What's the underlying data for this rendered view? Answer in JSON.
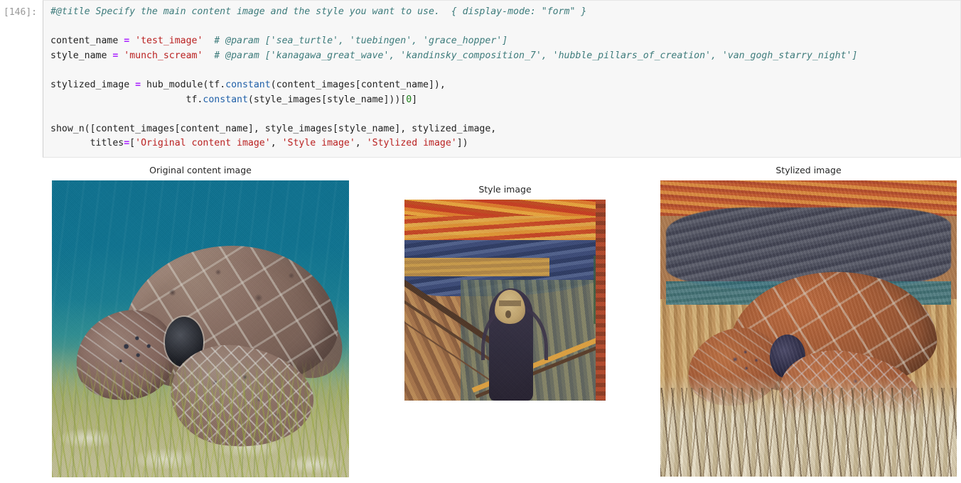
{
  "cell": {
    "prompt": "[146]:",
    "code_lines": [
      [
        {
          "t": "comment",
          "v": "#@title Specify the main content image and the style you want to use.  { display-mode: \"form\" }"
        }
      ],
      [],
      [
        {
          "t": "name",
          "v": "content_name "
        },
        {
          "t": "op",
          "v": "="
        },
        {
          "t": "plain",
          "v": " "
        },
        {
          "t": "string",
          "v": "'test_image'"
        },
        {
          "t": "plain",
          "v": "  "
        },
        {
          "t": "comment",
          "v": "# @param ['sea_turtle', 'tuebingen', 'grace_hopper']"
        }
      ],
      [
        {
          "t": "name",
          "v": "style_name "
        },
        {
          "t": "op",
          "v": "="
        },
        {
          "t": "plain",
          "v": " "
        },
        {
          "t": "string",
          "v": "'munch_scream'"
        },
        {
          "t": "plain",
          "v": "  "
        },
        {
          "t": "comment",
          "v": "# @param ['kanagawa_great_wave', 'kandinsky_composition_7', 'hubble_pillars_of_creation', 'van_gogh_starry_night']"
        }
      ],
      [],
      [
        {
          "t": "name",
          "v": "stylized_image "
        },
        {
          "t": "op",
          "v": "="
        },
        {
          "t": "plain",
          "v": " hub_module(tf."
        },
        {
          "t": "builtin",
          "v": "constant"
        },
        {
          "t": "plain",
          "v": "(content_images[content_name]),"
        }
      ],
      [
        {
          "t": "plain",
          "v": "                        tf."
        },
        {
          "t": "builtin",
          "v": "constant"
        },
        {
          "t": "plain",
          "v": "(style_images[style_name]))["
        },
        {
          "t": "number",
          "v": "0"
        },
        {
          "t": "plain",
          "v": "]"
        }
      ],
      [],
      [
        {
          "t": "plain",
          "v": "show_n([content_images[content_name], style_images[style_name], stylized_image,"
        }
      ],
      [
        {
          "t": "plain",
          "v": "       titles"
        },
        {
          "t": "op",
          "v": "="
        },
        {
          "t": "plain",
          "v": "["
        },
        {
          "t": "string",
          "v": "'Original content image'"
        },
        {
          "t": "plain",
          "v": ", "
        },
        {
          "t": "string",
          "v": "'Style image'"
        },
        {
          "t": "plain",
          "v": ", "
        },
        {
          "t": "string",
          "v": "'Stylized image'"
        },
        {
          "t": "plain",
          "v": "])"
        }
      ]
    ]
  },
  "output": {
    "panels": [
      {
        "title": "Original content image",
        "key": "content",
        "alt": "sea turtle grazing on seagrass underwater"
      },
      {
        "title": "Style image",
        "key": "style",
        "alt": "Edvard Munch The Scream painting"
      },
      {
        "title": "Stylized image",
        "key": "stylized",
        "alt": "sea turtle rendered in The Scream style"
      }
    ]
  },
  "colors": {
    "cell_background": "#f7f7f7",
    "cell_border": "#e6e6e6",
    "prompt_text": "#999999",
    "code_text": "#222222",
    "string": "#ba2121",
    "comment": "#3d7b7b",
    "operator": "#aa22ff",
    "builtin": "#2060a8",
    "number": "#1a8016",
    "title_text": "#262626",
    "page_background": "#ffffff"
  }
}
